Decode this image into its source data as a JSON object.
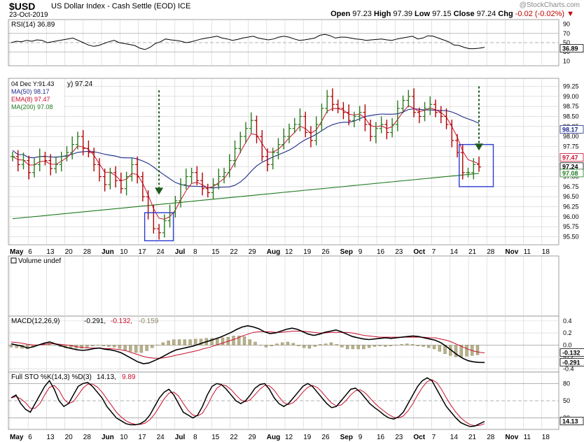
{
  "header": {
    "symbol": "$USD",
    "description": "US Dollar Index - Cash Settle (EOD)",
    "exchange": "ICE",
    "date": "23-Oct-2019",
    "watermark": "@StockCharts.com",
    "open_label": "Open",
    "open": "97.23",
    "high_label": "High",
    "high": "97.39",
    "low_label": "Low",
    "low": "97.15",
    "close_label": "Close",
    "close": "97.24",
    "chg_label": "Chg",
    "chg": "-0.02 (-0.02%)"
  },
  "colors": {
    "up": "#2a7a1e",
    "down": "#b00000",
    "ma50": "#1c2b8a",
    "ema8": "#c8102e",
    "ma200": "#1f7a1f",
    "grid": "#d0d0d0",
    "box": "#2b3ccf",
    "arrow": "#1f5a1f",
    "volume_bar": "#b8b08a"
  },
  "chart_data": [
    {
      "type": "line",
      "panel": "RSI",
      "label": "RSI(14) 36.89",
      "y_ticks": [
        "10",
        "30",
        "50",
        "70",
        "90"
      ],
      "ylim": [
        0,
        100
      ],
      "reference_lines": [
        30,
        50,
        70
      ],
      "last_value": "36.89",
      "values": [
        50,
        53,
        52,
        55,
        53,
        56,
        55,
        50,
        52,
        54,
        56,
        58,
        60,
        55,
        50,
        45,
        42,
        44,
        48,
        52,
        55,
        50,
        48,
        46,
        44,
        38,
        35,
        40,
        48,
        52,
        58,
        56,
        55,
        53,
        50,
        52,
        55,
        58,
        60,
        62,
        64,
        60,
        58,
        55,
        57,
        60,
        62,
        64,
        60,
        58,
        56,
        58,
        62,
        64,
        62,
        58,
        55,
        56,
        58,
        60,
        66,
        68,
        65,
        60,
        62,
        62,
        60,
        58,
        57,
        55,
        56,
        57,
        58,
        56,
        55,
        58,
        60,
        62,
        64,
        58,
        60,
        65,
        64,
        60,
        56,
        52,
        45,
        44,
        40,
        37,
        37,
        38,
        40
      ]
    },
    {
      "type": "candlestick",
      "panel": "price",
      "legend": [
        {
          "label": "04 Dec Y:91.43",
          "color": "#000000"
        },
        {
          "label": "MA(50) 98.17",
          "color": "#1c2b8a"
        },
        {
          "label": "EMA(8) 97.47",
          "color": "#c8102e"
        },
        {
          "label": "MA(200) 97.08",
          "color": "#1f7a1f"
        }
      ],
      "legend_suffix": "y) 97.24",
      "ylim": [
        95.3,
        99.45
      ],
      "y_ticks": [
        "95.50",
        "95.75",
        "96.00",
        "96.25",
        "96.50",
        "96.75",
        "97.00",
        "97.25",
        "97.50",
        "97.75",
        "98.00",
        "98.25",
        "98.50",
        "98.75",
        "99.00",
        "99.25"
      ],
      "price_tags": [
        {
          "value": 98.17,
          "label": "98.17",
          "color": "#1c2b8a"
        },
        {
          "value": 97.47,
          "label": "97.47",
          "color": "#c8102e"
        },
        {
          "value": 97.24,
          "label": "97.24",
          "color": "#000000"
        },
        {
          "value": 97.08,
          "label": "97.08",
          "color": "#1f7a1f"
        }
      ],
      "closes": [
        97.5,
        97.3,
        97.4,
        97.1,
        97.3,
        97.5,
        97.4,
        97.2,
        97.3,
        97.5,
        97.6,
        97.8,
        98.0,
        97.7,
        97.6,
        97.3,
        97.0,
        96.8,
        97.1,
        96.9,
        96.7,
        97.0,
        97.3,
        97.0,
        96.5,
        96.1,
        95.7,
        95.6,
        95.9,
        96.1,
        96.4,
        96.8,
        97.0,
        97.1,
        96.9,
        96.7,
        96.6,
        96.8,
        97.0,
        97.1,
        97.4,
        97.7,
        98.0,
        98.2,
        98.4,
        98.0,
        97.5,
        97.3,
        97.6,
        97.8,
        98.0,
        98.2,
        98.3,
        98.5,
        98.1,
        97.9,
        98.3,
        98.7,
        99.0,
        98.8,
        98.7,
        98.6,
        98.4,
        98.5,
        98.6,
        98.3,
        98.0,
        98.2,
        98.3,
        98.1,
        98.3,
        98.7,
        98.9,
        99.0,
        98.6,
        98.5,
        98.7,
        98.8,
        98.6,
        98.5,
        98.3,
        97.9,
        97.6,
        97.1,
        97.1,
        97.3,
        97.24
      ],
      "annotations": [
        {
          "type": "box",
          "from": 25,
          "to": 29,
          "low": 95.4,
          "high": 96.1
        },
        {
          "type": "arrow",
          "at": 27,
          "from_value": 99.15,
          "to_value": 96.55
        },
        {
          "type": "box",
          "from": 83,
          "to": 88,
          "low": 96.75,
          "high": 97.8
        },
        {
          "type": "arrow",
          "at": 86,
          "from_value": 99.25,
          "to_value": 97.65
        }
      ]
    },
    {
      "type": "bar",
      "panel": "volume",
      "label": "Volume undef",
      "values": []
    },
    {
      "type": "line",
      "panel": "MACD",
      "label": "MACD(12,26,9)",
      "macd_value": "-0.291",
      "signal_value": "-0.132",
      "histogram_value": "-0.159",
      "y_ticks": [
        "-0.4",
        "-0.2",
        "0.0",
        "0.2",
        "0.4"
      ],
      "ylim": [
        -0.45,
        0.48
      ],
      "price_tags": [
        {
          "value": -0.132,
          "label": "-0.132"
        },
        {
          "value": -0.291,
          "label": "-0.291"
        }
      ],
      "macd": [
        0.02,
        0.0,
        -0.02,
        -0.05,
        -0.03,
        0.0,
        0.03,
        0.05,
        0.02,
        -0.01,
        -0.04,
        -0.06,
        -0.08,
        -0.09,
        -0.08,
        -0.06,
        -0.05,
        -0.07,
        -0.08,
        -0.1,
        -0.13,
        -0.18,
        -0.23,
        -0.28,
        -0.31,
        -0.3,
        -0.26,
        -0.22,
        -0.17,
        -0.12,
        -0.08,
        -0.06,
        -0.04,
        -0.02,
        0.01,
        0.04,
        0.07,
        0.1,
        0.13,
        0.17,
        0.21,
        0.26,
        0.3,
        0.32,
        0.3,
        0.27,
        0.22,
        0.19,
        0.2,
        0.23,
        0.26,
        0.28,
        0.26,
        0.22,
        0.18,
        0.16,
        0.18,
        0.21,
        0.23,
        0.25,
        0.22,
        0.18,
        0.14,
        0.12,
        0.1,
        0.09,
        0.1,
        0.11,
        0.12,
        0.11,
        0.12,
        0.13,
        0.14,
        0.15,
        0.14,
        0.12,
        0.1,
        0.08,
        0.04,
        -0.02,
        -0.09,
        -0.16,
        -0.22,
        -0.26,
        -0.28,
        -0.29,
        -0.291
      ],
      "signal": [
        0.05,
        0.04,
        0.03,
        0.01,
        0.0,
        0.0,
        0.01,
        0.02,
        0.02,
        0.01,
        0.0,
        -0.01,
        -0.03,
        -0.04,
        -0.05,
        -0.05,
        -0.05,
        -0.06,
        -0.06,
        -0.07,
        -0.08,
        -0.1,
        -0.13,
        -0.16,
        -0.19,
        -0.21,
        -0.22,
        -0.22,
        -0.21,
        -0.19,
        -0.17,
        -0.15,
        -0.13,
        -0.11,
        -0.09,
        -0.06,
        -0.04,
        -0.01,
        0.02,
        0.05,
        0.08,
        0.11,
        0.15,
        0.18,
        0.21,
        0.22,
        0.22,
        0.22,
        0.21,
        0.21,
        0.22,
        0.23,
        0.23,
        0.23,
        0.22,
        0.21,
        0.2,
        0.2,
        0.21,
        0.21,
        0.21,
        0.21,
        0.2,
        0.18,
        0.16,
        0.15,
        0.14,
        0.13,
        0.13,
        0.13,
        0.13,
        0.13,
        0.13,
        0.13,
        0.13,
        0.13,
        0.12,
        0.12,
        0.1,
        0.08,
        0.05,
        0.01,
        -0.03,
        -0.07,
        -0.1,
        -0.12,
        -0.132
      ]
    },
    {
      "type": "line",
      "panel": "STO",
      "label": "Full STO %K(14,3) %D(3)",
      "k_value": "14.13",
      "d_value": "9.89",
      "y_ticks": [
        "20",
        "50",
        "80"
      ],
      "ylim": [
        0,
        100
      ],
      "reference_lines": [
        20,
        50,
        80
      ],
      "price_tags": [
        {
          "value": 14.13,
          "label": "14.13"
        }
      ],
      "k": [
        55,
        60,
        45,
        35,
        30,
        45,
        60,
        75,
        85,
        70,
        50,
        40,
        45,
        60,
        75,
        80,
        82,
        75,
        65,
        55,
        40,
        30,
        20,
        15,
        10,
        8,
        8,
        10,
        15,
        25,
        40,
        55,
        65,
        70,
        60,
        45,
        30,
        25,
        20,
        25,
        40,
        60,
        75,
        80,
        78,
        70,
        60,
        50,
        45,
        50,
        60,
        72,
        78,
        80,
        70,
        55,
        45,
        40,
        45,
        55,
        65,
        75,
        80,
        75,
        65,
        55,
        45,
        38,
        40,
        50,
        60,
        70,
        72,
        65,
        55,
        45,
        38,
        32,
        25,
        20,
        18,
        22,
        30,
        45,
        60,
        75,
        85,
        90,
        85,
        70,
        55,
        40,
        30,
        20,
        12,
        8,
        5,
        6,
        10,
        14
      ]
    }
  ],
  "x_axis": {
    "labels": [
      "May",
      "6",
      "13",
      "20",
      "28",
      "Jun",
      "10",
      "17",
      "24",
      "Jul",
      "8",
      "15",
      "22",
      "29",
      "Aug",
      "12",
      "19",
      "26",
      "Sep",
      "9",
      "16",
      "23",
      "Oct",
      "7",
      "14",
      "21",
      "28",
      "Nov",
      "11",
      "18"
    ],
    "bold": [
      "May",
      "Jun",
      "Jul",
      "Aug",
      "Sep",
      "Oct",
      "Nov"
    ]
  }
}
